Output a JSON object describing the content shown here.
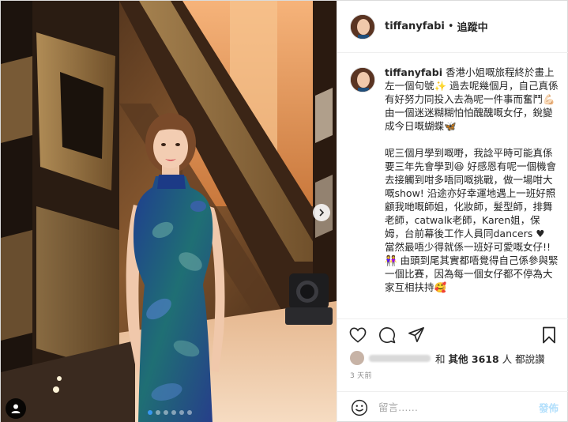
{
  "post": {
    "username": "tiffanyfabi",
    "separator": "•",
    "follow_label": "追蹤中"
  },
  "caption": {
    "username": "tiffanyfabi",
    "paragraph1": "香港小姐嘅旅程終於畫上左一個句號✨ 過去呢幾個月，自己真係有好努力同投入去為呢一件事而奮鬥💪🏻 由一個迷迷糊糊怕怕醜醜嘅女仔，銳變成今日嘅蝴蝶🦋",
    "paragraph2": "呢三個月學到嘅嘢，我諗平時可能真係要三年先會學到😆 好感恩有呢一個機會去接觸到咁多唔同嘅挑戰，做一場咁大嘅show! 沿途亦好幸運地遇上一班好照顧我哋嘅師姐，化妝師，髮型師，排舞老師，catwalk老師，Karen姐，保姆，台前幕後工作人員同dancers ♥",
    "paragraph3": "當然最唔少得就係一班好可愛嘅女仔!! 👭 由頭到尾其實都唔覺得自己係參與緊一個比賽，因為每一個女仔都不停為大家互相扶持🥰"
  },
  "likes": {
    "and": "和",
    "others": "其他",
    "count": "3618",
    "suffix": "人 都說讚"
  },
  "timestamp": "3 天前",
  "comment": {
    "placeholder": "留言……",
    "post_label": "發佈"
  },
  "carousel": {
    "total_slides": 6,
    "active_index": 0
  },
  "colors": {
    "accent": "#3897f0",
    "post_button_disabled": "#b2dffc",
    "dress_blue": "#1f3d8f",
    "dress_teal": "#1f6f74",
    "backdrop_gold": "#b98a4f"
  },
  "icons": [
    "heart-icon",
    "comment-icon",
    "share-icon",
    "bookmark-icon",
    "emoji-icon",
    "chevron-right-icon",
    "user-tag-icon"
  ]
}
